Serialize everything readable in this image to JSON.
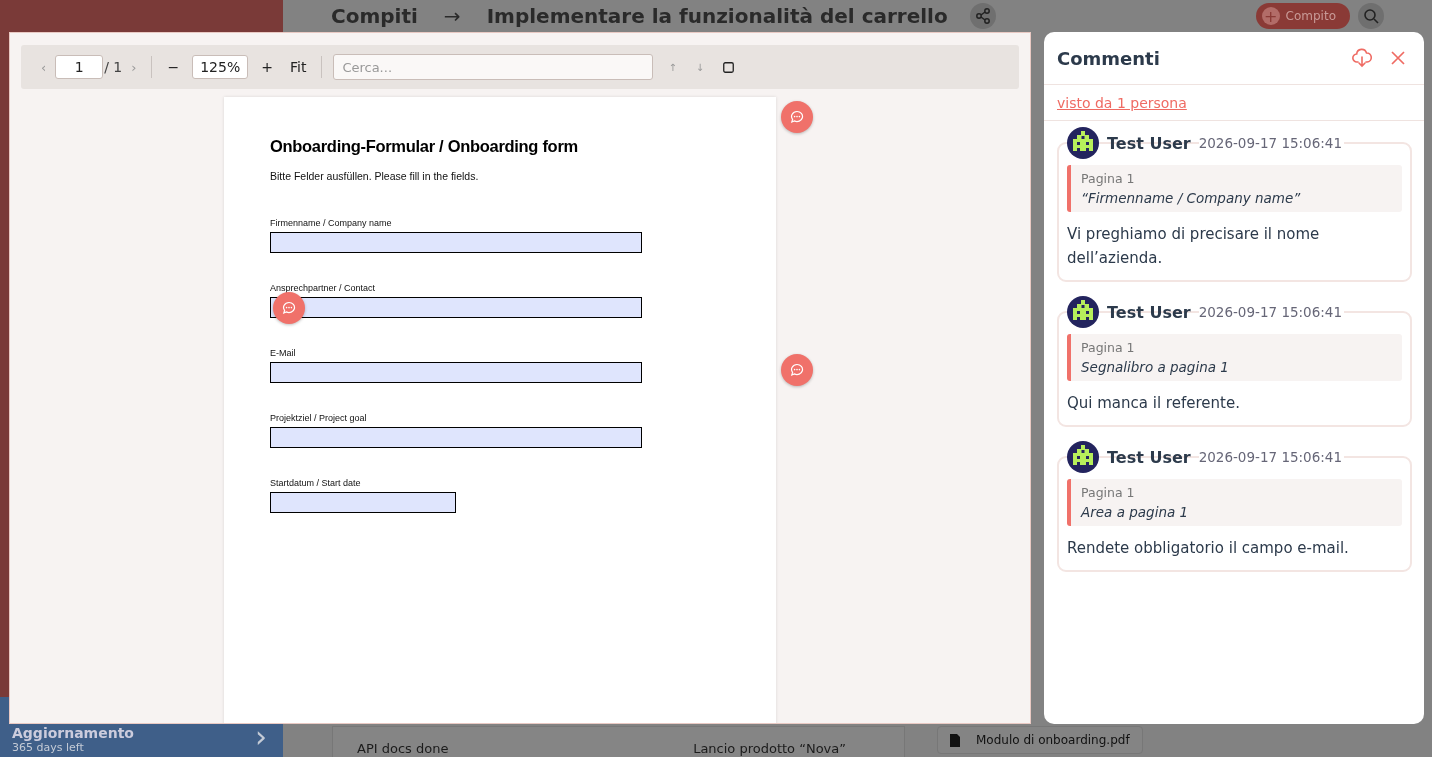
{
  "background": {
    "sidebar_item": {
      "title": "Aggiornamento",
      "subtitle": "365 days left",
      "chevron": "›"
    },
    "breadcrumb": {
      "section": "Compiti",
      "separator": "→",
      "title": "Implementare la funzionalità del carrello"
    },
    "new_task_button": {
      "icon": "+",
      "label": "Compito"
    },
    "table_rows": [
      {
        "column_1": "API docs done",
        "column_2": "Lancio prodotto “Nova”"
      }
    ],
    "attachment": "Modulo di onboarding.pdf"
  },
  "viewer": {
    "toolbar": {
      "prev": "‹",
      "page": "1",
      "page_total": "/ 1",
      "next": "›",
      "zoom_out": "−",
      "zoom": "125%",
      "zoom_in": "+",
      "fit": "Fit",
      "search_placeholder": "Cerca...",
      "up": "↑",
      "down": "↓"
    },
    "document": {
      "title": "Onboarding-Formular / Onboarding form",
      "intro": "Bitte Felder ausfüllen. Please fill in the fields.",
      "fields": [
        {
          "label": "Firmenname / Company name",
          "kind": "wide"
        },
        {
          "label": "Ansprechpartner / Contact",
          "kind": "wide"
        },
        {
          "label": "E-Mail",
          "kind": "wide"
        },
        {
          "label": "Projektziel / Project goal",
          "kind": "wide"
        },
        {
          "label": "Startdatum / Start date",
          "kind": "narrow"
        }
      ]
    }
  },
  "comments": {
    "title": "Commenti",
    "seen_by": "visto da 1 persona",
    "items": [
      {
        "author": "Test User",
        "time": "2026-09-17 15:06:41",
        "page": "Pagina 1",
        "quote": "“Firmenname / Company name”",
        "text": "Vi preghiamo di precisare il nome dell’azienda."
      },
      {
        "author": "Test User",
        "time": "2026-09-17 15:06:41",
        "page": "Pagina 1",
        "quote": "Segnalibro a pagina 1",
        "text": "Qui manca il referente."
      },
      {
        "author": "Test User",
        "time": "2026-09-17 15:06:41",
        "page": "Pagina 1",
        "quote": "Area a pagina 1",
        "text": "Rendete obbligatorio il campo e-mail."
      }
    ]
  }
}
